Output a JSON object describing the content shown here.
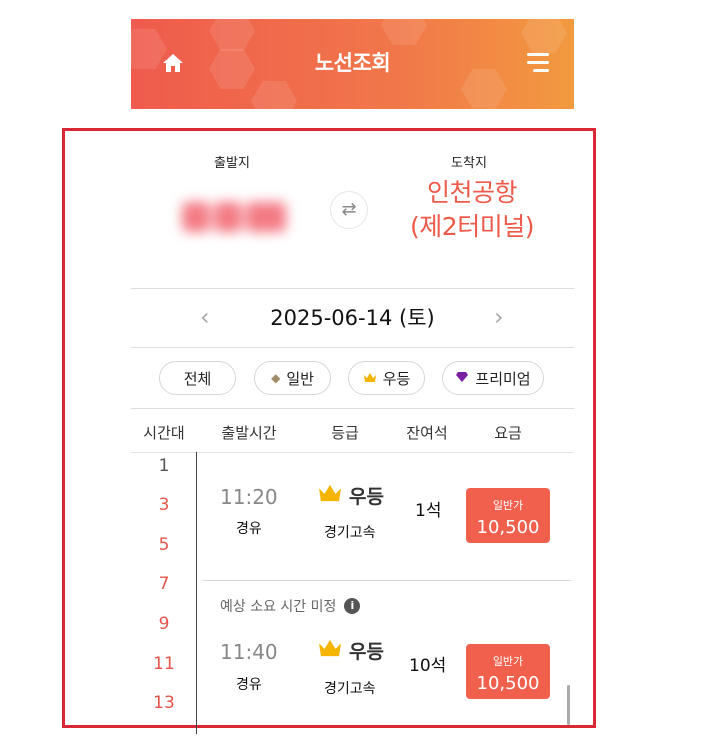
{
  "header": {
    "title": "노선조회",
    "home_icon": "home-icon",
    "menu_icon": "hamburger-menu-icon",
    "gradient_start": "#ef5b4d",
    "gradient_end": "#f29a3f"
  },
  "route": {
    "departure_label": "출발지",
    "arrival_label": "도착지",
    "arrival_name_line1": "인천공항",
    "arrival_name_line2": "(제2터미널)",
    "swap_icon": "swap-arrows-icon"
  },
  "date_nav": {
    "date": "2025-06-14 (토)",
    "prev_icon": "chevron-left-icon",
    "next_icon": "chevron-right-icon"
  },
  "filters": {
    "all": "전체",
    "general": "일반",
    "premium_grade": "우등",
    "premium": "프리미엄"
  },
  "columns": {
    "time_slot": "시간대",
    "departure_time": "출발시간",
    "grade": "등급",
    "remaining_seats": "잔여석",
    "fare": "요금"
  },
  "hours": [
    "1",
    "3",
    "5",
    "7",
    "9",
    "11",
    "13"
  ],
  "trips": [
    {
      "time": "11:20",
      "via": "경유",
      "grade": "우등",
      "highway": "경기고속",
      "seats": "1석",
      "fare_type": "일반가",
      "fare": "10,500"
    },
    {
      "estimate": "예상 소요 시간 미정",
      "time": "11:40",
      "via": "경유",
      "grade": "우등",
      "highway": "경기고속",
      "seats": "10석",
      "fare_type": "일반가",
      "fare": "10,500"
    }
  ],
  "colors": {
    "accent": "#ee5a4a",
    "frame": "#d92835",
    "fare_button": "#f0604c",
    "crown": "#f4b400",
    "diamond": "#7b1fa2"
  }
}
